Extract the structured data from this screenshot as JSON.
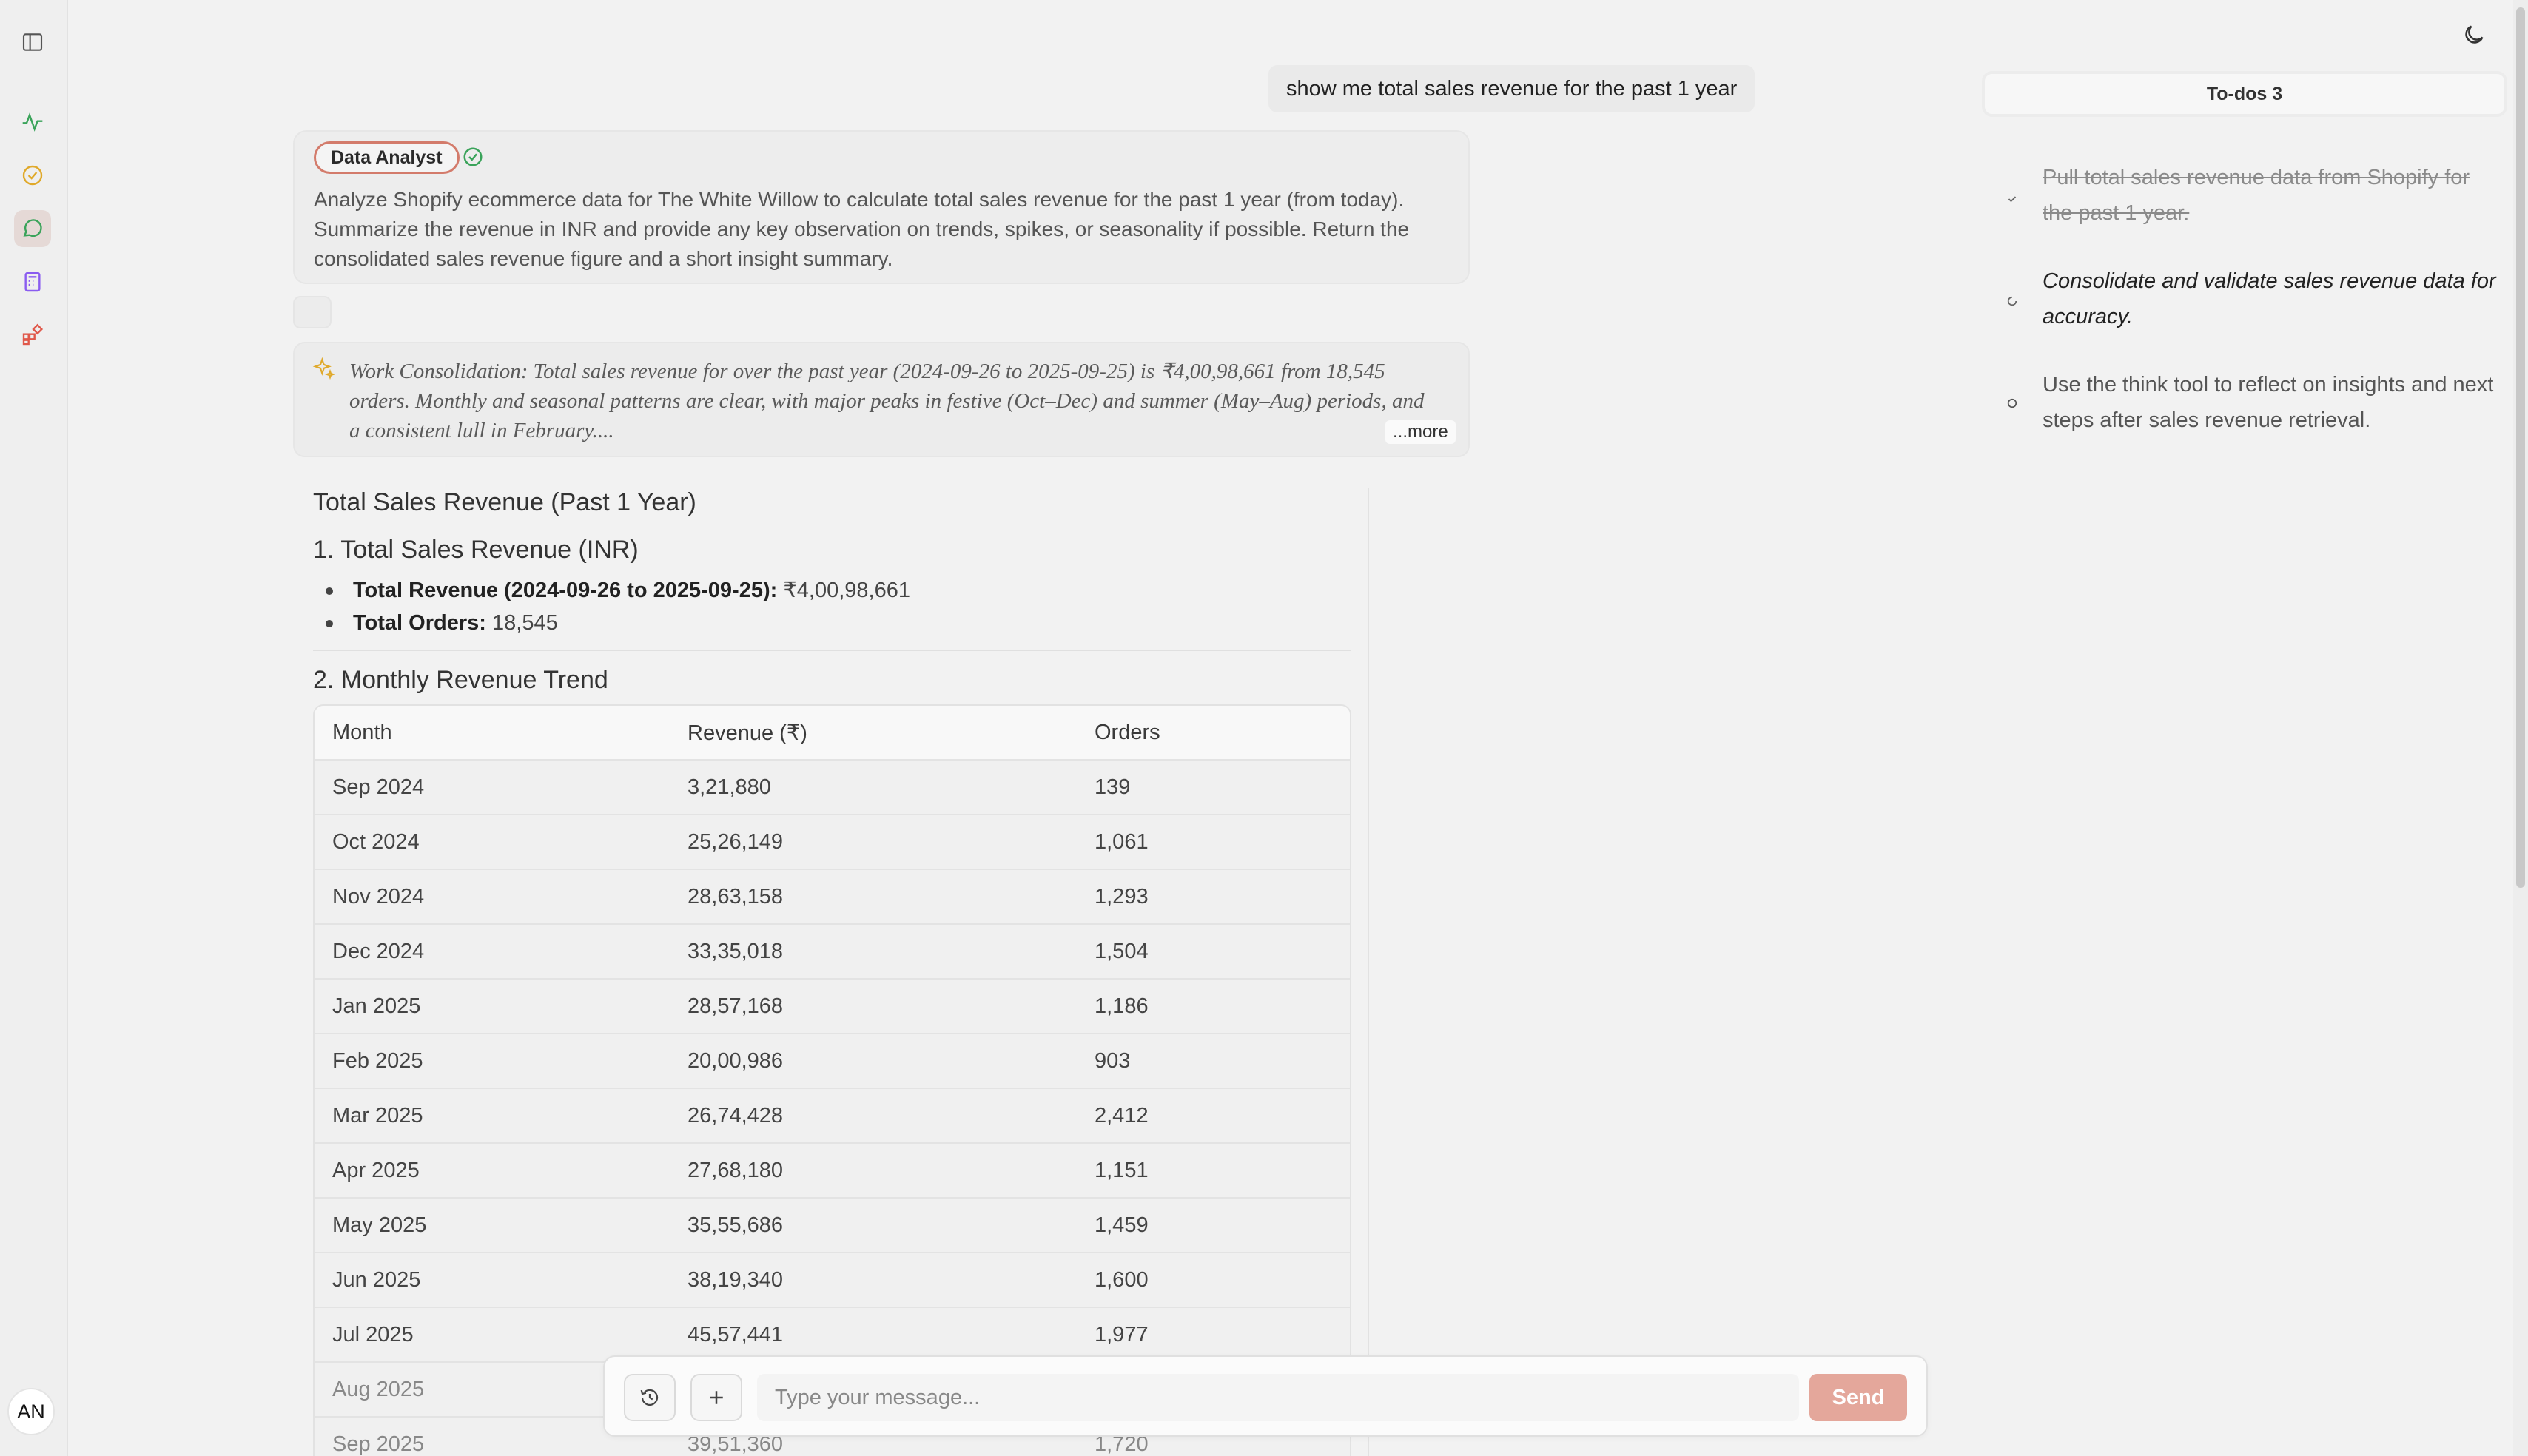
{
  "sidebar": {
    "icons": [
      "sidebar-toggle-icon",
      "activity-icon",
      "check-circle-icon",
      "chat-icon",
      "calculator-icon",
      "apps-icon"
    ],
    "avatar_initials": "AN"
  },
  "chat": {
    "user_message": "show me total sales revenue for the past 1 year",
    "agent": {
      "name": "Data Analyst",
      "description": "Analyze Shopify ecommerce data for The White Willow to calculate total sales revenue for the past 1 year (from today). Summarize the revenue in INR and provide any key observation on trends, spikes, or seasonality if possible. Return the consolidated sales revenue figure and a short insight summary."
    },
    "consolidation": {
      "text": "Work Consolidation: Total sales revenue for over the past year (2024-09-26 to 2025-09-25) is ₹4,00,98,661 from 18,545 orders. Monthly and seasonal patterns are clear, with major peaks in festive (Oct–Dec) and summer (May–Aug) periods, and a consistent lull in February....",
      "more_label": "...more"
    }
  },
  "report": {
    "title": "Total Sales Revenue (Past 1 Year)",
    "section1_title": "1. Total Sales Revenue (INR)",
    "total_revenue_label": "Total Revenue (2024-09-26 to 2025-09-25):",
    "total_revenue_value": "₹4,00,98,661",
    "total_orders_label": "Total Orders:",
    "total_orders_value": "18,545",
    "section2_title": "2. Monthly Revenue Trend",
    "table": {
      "headers": [
        "Month",
        "Revenue (₹)",
        "Orders"
      ],
      "rows": [
        [
          "Sep 2024",
          "3,21,880",
          "139"
        ],
        [
          "Oct 2024",
          "25,26,149",
          "1,061"
        ],
        [
          "Nov 2024",
          "28,63,158",
          "1,293"
        ],
        [
          "Dec 2024",
          "33,35,018",
          "1,504"
        ],
        [
          "Jan 2025",
          "28,57,168",
          "1,186"
        ],
        [
          "Feb 2025",
          "20,00,986",
          "903"
        ],
        [
          "Mar 2025",
          "26,74,428",
          "2,412"
        ],
        [
          "Apr 2025",
          "27,68,180",
          "1,151"
        ],
        [
          "May 2025",
          "35,55,686",
          "1,459"
        ],
        [
          "Jun 2025",
          "38,19,340",
          "1,600"
        ],
        [
          "Jul 2025",
          "45,57,441",
          "1,977"
        ],
        [
          "Aug 2025",
          "",
          ""
        ],
        [
          "Sep 2025",
          "39,51,360",
          "1,720"
        ]
      ]
    }
  },
  "composer": {
    "placeholder": "Type your message...",
    "send_label": "Send"
  },
  "todos": {
    "header": "To-dos 3",
    "items": [
      {
        "text": "Pull total sales revenue data from Shopify for the past 1 year.",
        "status": "done"
      },
      {
        "text": "Consolidate and validate sales revenue data for accuracy.",
        "status": "in-progress"
      },
      {
        "text": "Use the think tool to reflect on insights and next steps after sales revenue retrieval.",
        "status": "pending"
      }
    ]
  },
  "colors": {
    "accent": "#e4a79b",
    "badge_border": "#d37b6b",
    "success": "#3aa35a"
  }
}
